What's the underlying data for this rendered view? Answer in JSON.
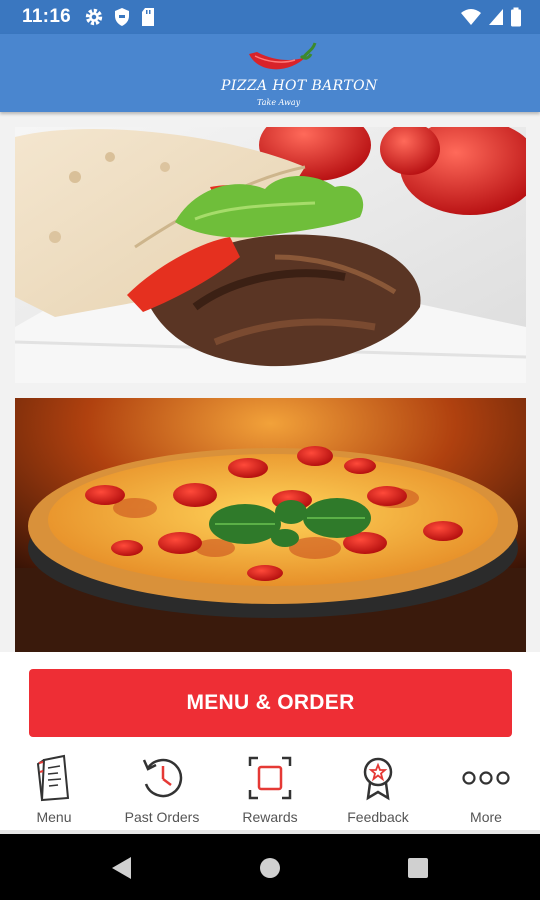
{
  "status_bar": {
    "time": "11:16"
  },
  "app": {
    "logo_name": "PIZZA HOT BARTON",
    "logo_subtitle": "Take Away"
  },
  "cta": {
    "label": "MENU & ORDER"
  },
  "nav": [
    {
      "label": "Menu",
      "icon": "menu-book-icon"
    },
    {
      "label": "Past Orders",
      "icon": "history-clock-icon"
    },
    {
      "label": "Rewards",
      "icon": "rewards-frame-icon"
    },
    {
      "label": "Feedback",
      "icon": "feedback-badge-icon"
    },
    {
      "label": "More",
      "icon": "more-dots-icon"
    }
  ],
  "colors": {
    "status_bar": "#3a77c0",
    "app_bar": "#4a86cf",
    "accent": "#ee2e35"
  }
}
